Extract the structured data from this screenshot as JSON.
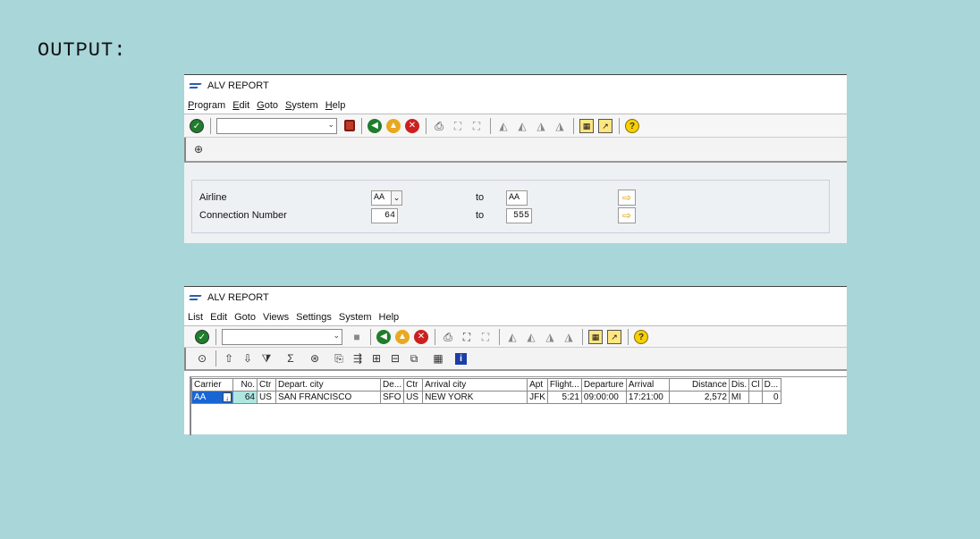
{
  "heading": "OUTPUT:",
  "window1": {
    "title": "ALV REPORT",
    "menu": [
      "Program",
      "Edit",
      "Goto",
      "System",
      "Help"
    ],
    "app_toolbar_icon": "execute-clock-icon",
    "selection": {
      "airline_label": "Airline",
      "airline_from": "AA",
      "airline_to": "AA",
      "connection_label": "Connection Number",
      "connection_from": "64",
      "connection_to": "555",
      "to_label": "to"
    }
  },
  "window2": {
    "title": "ALV REPORT",
    "menu": [
      "List",
      "Edit",
      "Goto",
      "Views",
      "Settings",
      "System",
      "Help"
    ],
    "columns": [
      "Carrier",
      "No.",
      "Ctr",
      "Depart. city",
      "De...",
      "Ctr",
      "Arrival city",
      "Apt",
      "Flight...",
      "Departure",
      "Arrival",
      "Distance",
      "Dis.",
      "Cl",
      "D..."
    ],
    "rows": [
      [
        "AA",
        "64",
        "US",
        "SAN FRANCISCO",
        "SFO",
        "US",
        "NEW YORK",
        "JFK",
        "5:21",
        "09:00:00",
        "17:21:00",
        "2,572",
        "MI",
        "",
        "0"
      ]
    ]
  },
  "colors": {
    "background": "#a8d6d9",
    "selected_cell": "#1766d4",
    "key_cell": "#aee7e2"
  }
}
